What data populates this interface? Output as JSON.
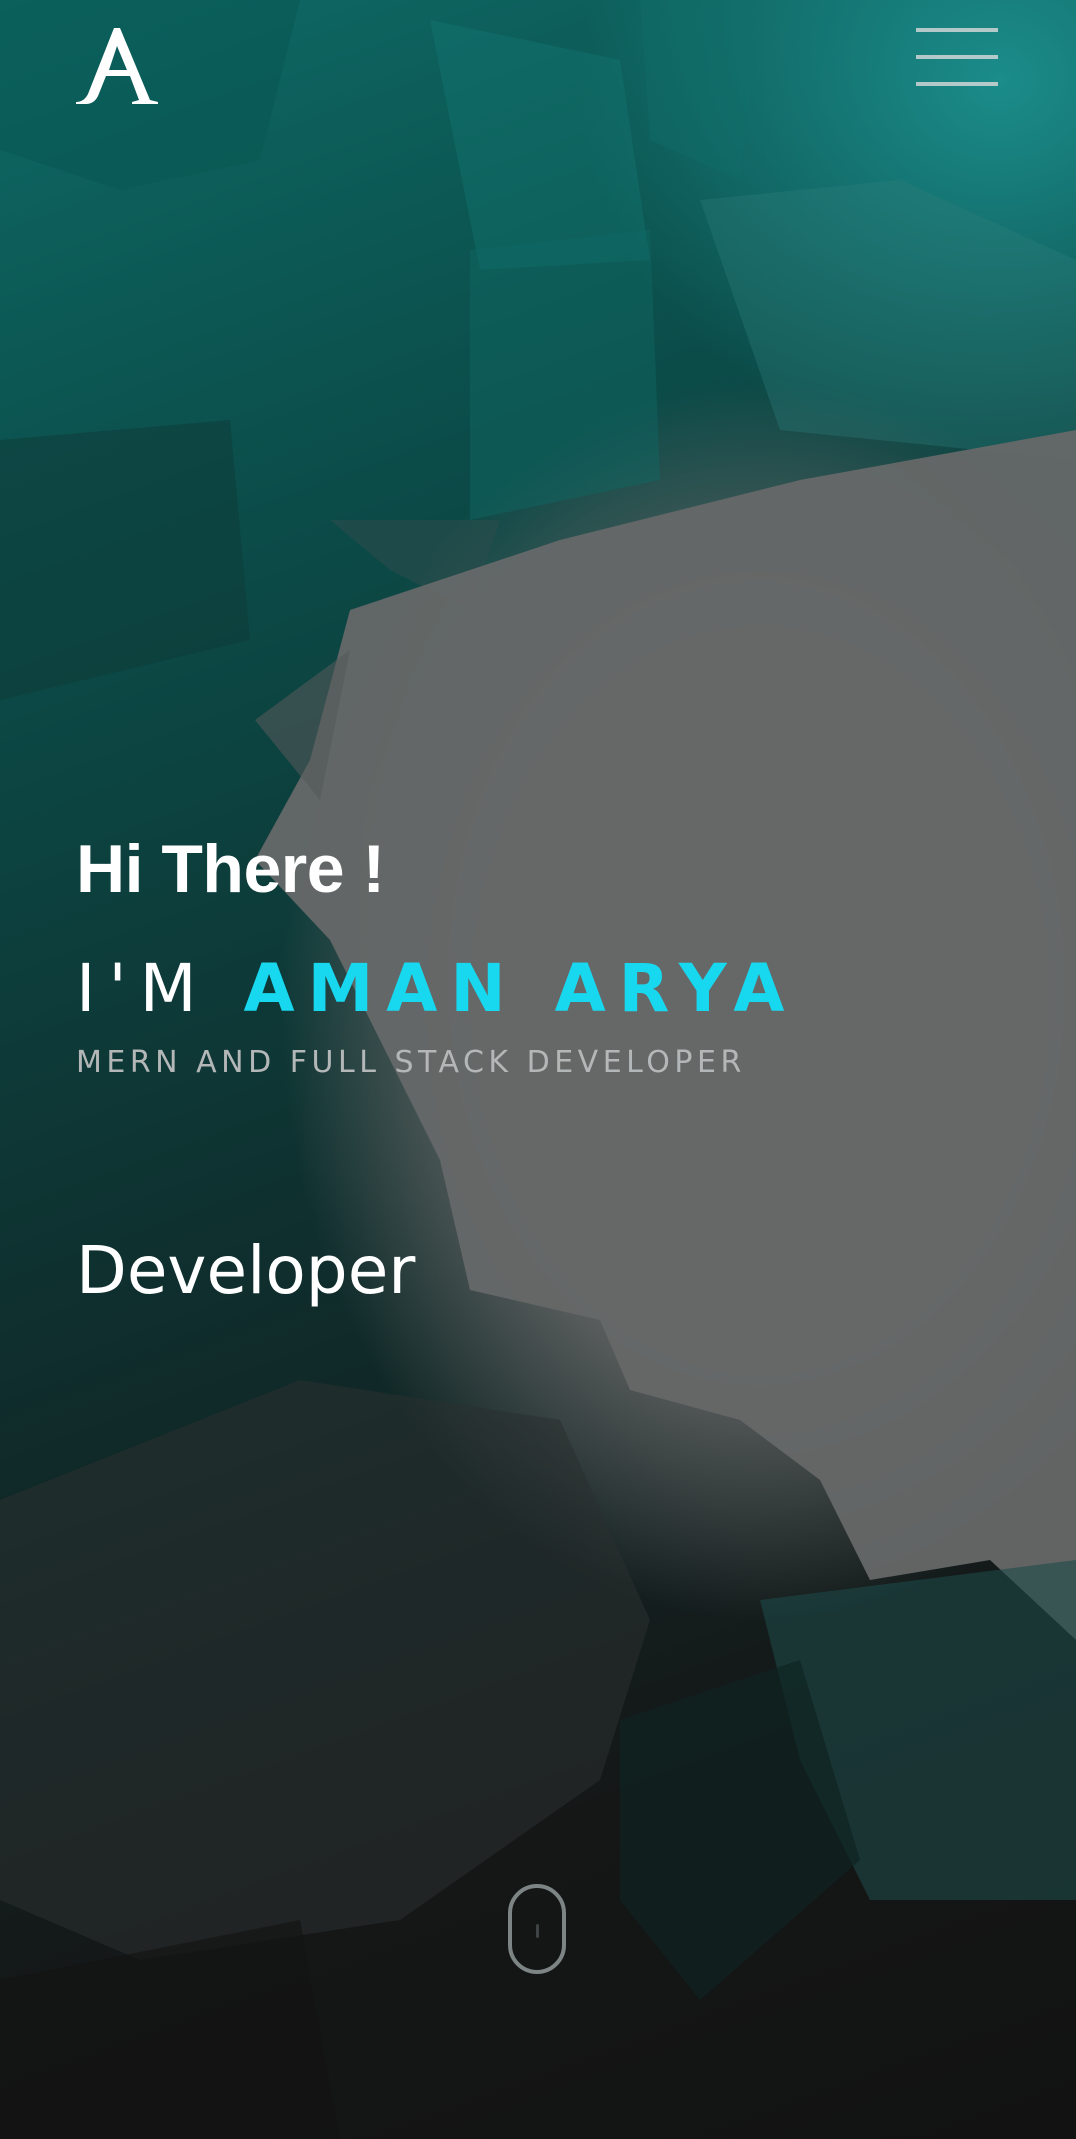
{
  "header": {
    "logo_icon": "stylized-letter-a-logo",
    "menu_icon": "hamburger-menu-icon"
  },
  "hero": {
    "greeting": "Hi There !",
    "intro_prefix": "I'M",
    "name": "AMAN ARYA",
    "role": "MERN AND FULL STACK DEVELOPER",
    "typed_text": "Developer",
    "scroll_icon": "mouse-scroll-icon"
  },
  "colors": {
    "accent": "#18d8f0",
    "text": "#ffffff",
    "subtle_text": "#b4b7b7",
    "teal_background": "#0b4b48",
    "dark_background": "#151515"
  }
}
